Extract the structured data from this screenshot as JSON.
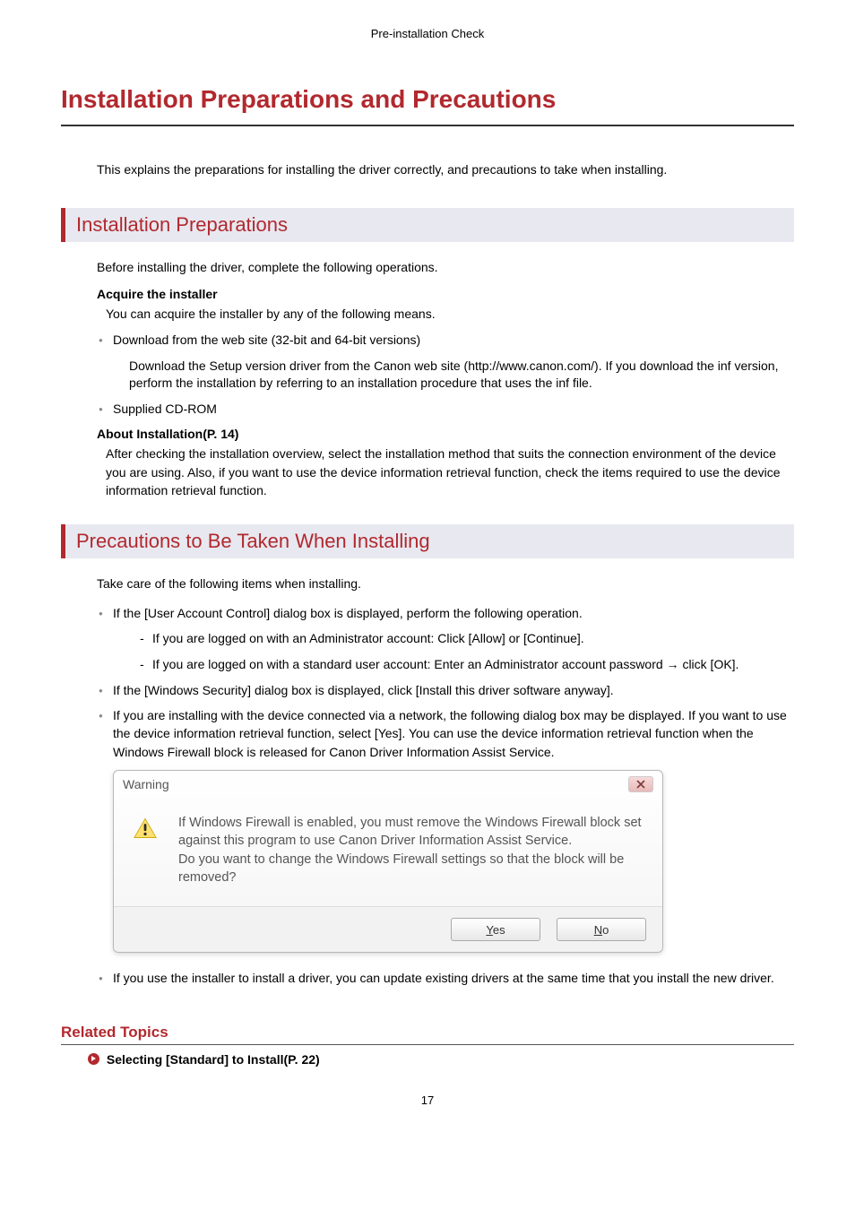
{
  "running_header": "Pre-installation Check",
  "title": "Installation Preparations and Precautions",
  "intro": "This explains the preparations for installing the driver correctly, and precautions to take when installing.",
  "section1": {
    "heading": "Installation Preparations",
    "lead": "Before installing the driver, complete the following operations.",
    "acquire_label": "Acquire the installer",
    "acquire_text": "You can acquire the installer by any of the following means.",
    "bullet1": "Download from the web site (32-bit and 64-bit versions)",
    "bullet1_desc": "Download the Setup version driver from the Canon web site (http://www.canon.com/). If you download the inf version, perform the installation by referring to an installation procedure that uses the inf file.",
    "bullet2": "Supplied CD-ROM",
    "about_label": "About Installation(P. 14)",
    "about_text": "After checking the installation overview, select the installation method that suits the connection environment of the device you are using. Also, if you want to use the device information retrieval function, check the items required to use the device information retrieval function."
  },
  "section2": {
    "heading": "Precautions to Be Taken When Installing",
    "lead": "Take care of the following items when installing.",
    "b1": "If the [User Account Control] dialog box is displayed, perform the following operation.",
    "b1a": "If you are logged on with an Administrator account: Click [Allow] or [Continue].",
    "b1b": "If you are logged on with a standard user account: Enter an Administrator account password → click [OK].",
    "b2": "If the [Windows Security] dialog box is displayed, click [Install this driver software anyway].",
    "b3": "If you are installing with the device connected via a network, the following dialog box may be displayed. If you want to use the device information retrieval function, select [Yes]. You can use the device information retrieval function when the Windows Firewall block is released for Canon Driver Information Assist Service.",
    "b4": "If you use the installer to install a driver, you can update existing drivers at the same time that you install the new driver."
  },
  "dialog": {
    "title": "Warning",
    "message_l1": "If Windows Firewall is enabled, you must remove the Windows Firewall block set against this program to use Canon Driver Information Assist Service.",
    "message_l2": "Do you want to change the Windows Firewall settings so that the block will be removed?",
    "yes_u": "Y",
    "yes_rest": "es",
    "no_u": "N",
    "no_rest": "o"
  },
  "related": {
    "heading": "Related Topics",
    "link1": "Selecting [Standard] to Install(P. 22)"
  },
  "page_number": "17"
}
